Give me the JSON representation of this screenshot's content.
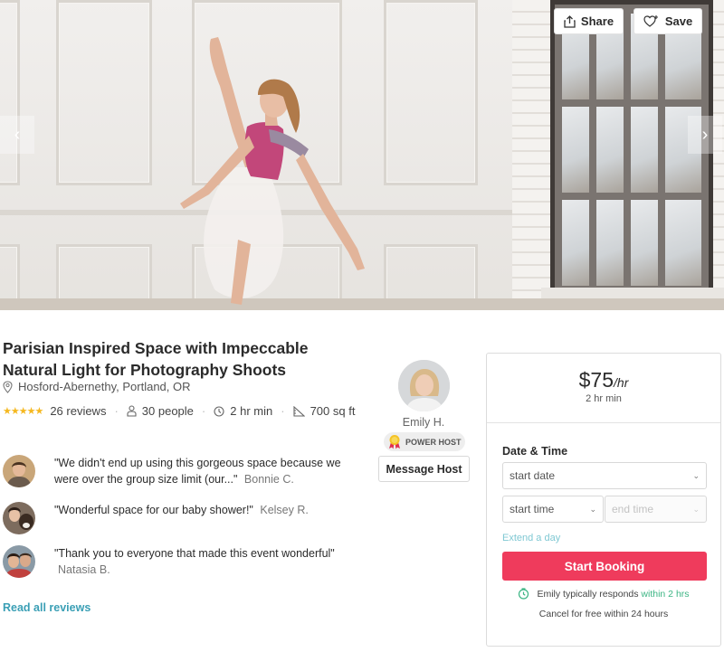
{
  "hero": {
    "share_label": "Share",
    "save_label": "Save"
  },
  "listing": {
    "title": "Parisian Inspired Space with Impeccable Natural Light for Photography Shoots",
    "location": "Hosford-Abernethy, Portland, OR",
    "rating_stars": 5,
    "reviews_count": "26 reviews",
    "capacity": "30 people",
    "min_duration": "2 hr min",
    "area": "700 sq ft"
  },
  "host": {
    "name": "Emily H.",
    "badge": "POWER HOST",
    "message_label": "Message Host"
  },
  "reviews": [
    {
      "text": "\"We didn't end up using this gorgeous space because we were over the group size limit (our...\"",
      "author": "Bonnie C."
    },
    {
      "text": "\"Wonderful space for our baby shower!\"",
      "author": "Kelsey R."
    },
    {
      "text": "\"Thank you to everyone that made this event wonderful\"",
      "author": "Natasia B."
    }
  ],
  "read_all_label": "Read all reviews",
  "booking": {
    "price": "$75",
    "price_unit": "/hr",
    "min_hours": "2 hr min",
    "date_time_label": "Date & Time",
    "start_date_placeholder": "start date",
    "start_time_placeholder": "start time",
    "end_time_placeholder": "end time",
    "extend_label": "Extend a day",
    "book_label": "Start Booking",
    "responds_prefix": "Emily typically responds",
    "responds_time": "within 2 hrs",
    "cancel_text": "Cancel for free within 24 hours"
  },
  "colors": {
    "accent_pink": "#ef3b5c",
    "link_teal": "#3a9fb5",
    "star_gold": "#f5b820",
    "response_green": "#3cb584"
  }
}
